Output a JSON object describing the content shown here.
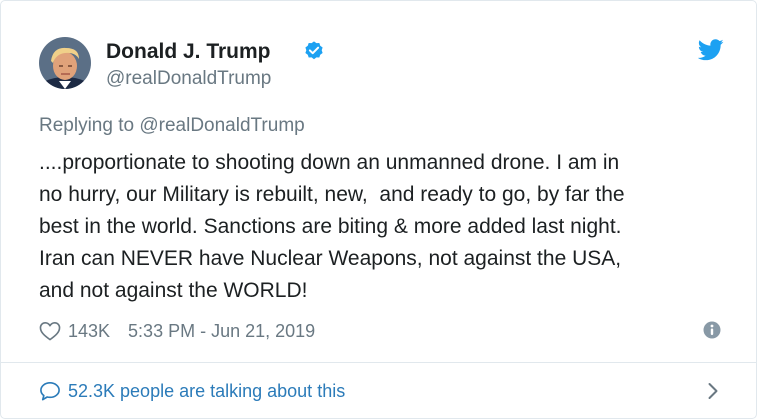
{
  "tweet": {
    "author": {
      "display_name": "Donald J. Trump",
      "handle": "@realDonaldTrump",
      "verified": true
    },
    "replying_to_prefix": "Replying to",
    "replying_to_handle": "@realDonaldTrump",
    "text_lines": [
      "....proportionate to shooting down an unmanned drone. I am in",
      "no hurry, our Military is rebuilt, new,  and ready to go, by far the",
      "best in the world. Sanctions are biting & more added last night.",
      "Iran can NEVER have Nuclear Weapons, not against the USA,",
      "and not against the WORLD!"
    ],
    "likes": "143K",
    "timestamp": "5:33 PM - Jun 21, 2019",
    "talking": "52.3K people are talking about this"
  },
  "icons": {
    "brand": "twitter-bird-icon",
    "verified": "verified-badge-icon",
    "like": "heart-icon",
    "info": "info-icon",
    "talking": "speech-bubble-icon",
    "chevron": "chevron-right-icon"
  },
  "colors": {
    "twitter_blue": "#1da1f2",
    "link_blue": "#2b7bb9",
    "text": "#1c2022",
    "secondary_text": "#697882",
    "border": "#e1e8ed"
  }
}
